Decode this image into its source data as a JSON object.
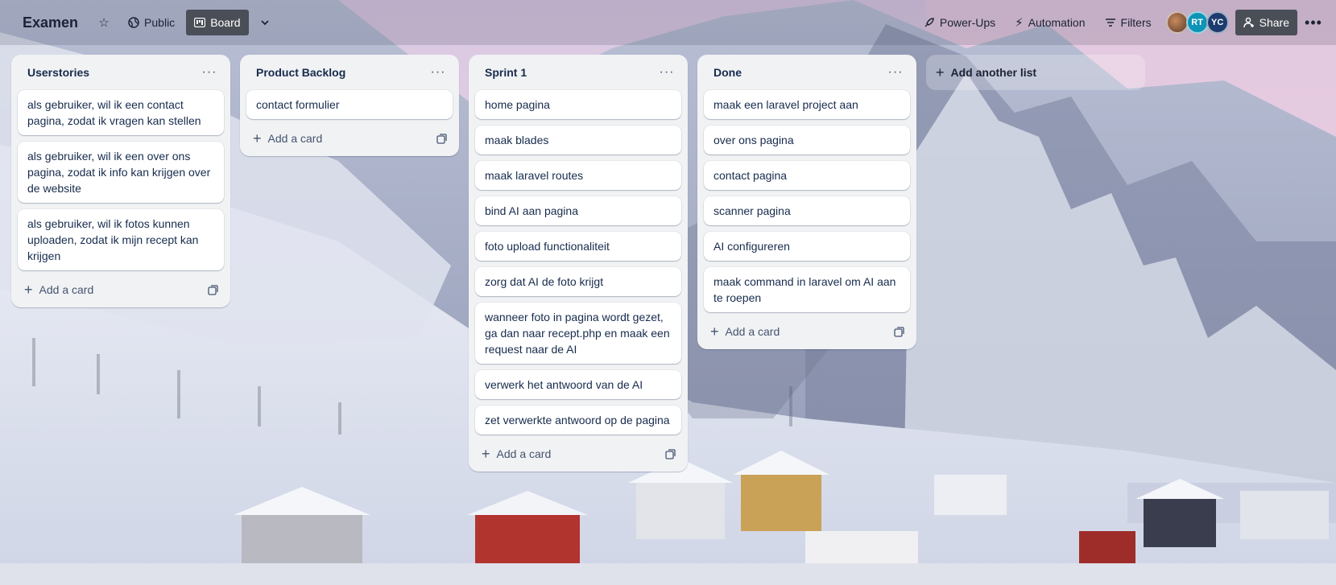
{
  "header": {
    "board_title": "Examen",
    "visibility_label": "Public",
    "view_label": "Board",
    "powerups_label": "Power-Ups",
    "automation_label": "Automation",
    "filters_label": "Filters",
    "avatars": [
      "RT",
      "YC"
    ],
    "share_label": "Share"
  },
  "lists": [
    {
      "title": "Userstories",
      "cards": [
        "als gebruiker, wil ik een contact pagina, zodat ik vragen kan stellen",
        "als gebruiker, wil ik een over ons pagina, zodat ik info kan krijgen over de website",
        "als gebruiker, wil ik fotos kunnen uploaden, zodat ik mijn recept kan krijgen"
      ],
      "add_card_label": "Add a card"
    },
    {
      "title": "Product Backlog",
      "cards": [
        "contact formulier"
      ],
      "add_card_label": "Add a card"
    },
    {
      "title": "Sprint 1",
      "cards": [
        "home pagina",
        "maak blades",
        "maak laravel routes",
        "bind AI aan pagina",
        "foto upload functionaliteit",
        "zorg dat AI de foto krijgt",
        "wanneer foto in pagina wordt gezet, ga dan naar recept.php en maak een request naar de AI",
        "verwerk het antwoord van de AI",
        "zet verwerkte antwoord op de pagina"
      ],
      "add_card_label": "Add a card"
    },
    {
      "title": "Done",
      "cards": [
        "maak een laravel project aan",
        "over ons pagina",
        "contact pagina",
        "scanner pagina",
        "AI configureren",
        "maak command in laravel om AI aan te roepen"
      ],
      "add_card_label": "Add a card"
    }
  ],
  "add_list_label": "Add another list",
  "colors": {
    "list_bg": "#f1f2f4",
    "card_bg": "#ffffff",
    "text": "#172b4d",
    "active_button": "#4a4e57"
  }
}
